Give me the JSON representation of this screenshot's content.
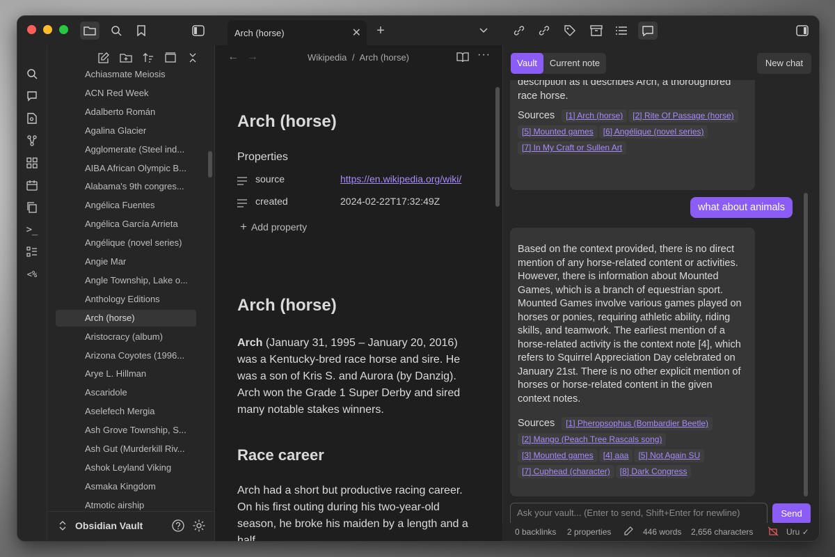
{
  "tab": {
    "title": "Arch (horse)"
  },
  "explorer": {
    "files": [
      "Achiasmate Meiosis",
      "ACN Red Week",
      "Adalberto Román",
      "Agalina Glacier",
      "Agglomerate (Steel ind...",
      "AIBA African Olympic B...",
      "Alabama's 9th congres...",
      "Angélica Fuentes",
      "Angélica García Arrieta",
      "Angélique (novel series)",
      "Angie Mar",
      "Angle Township, Lake o...",
      "Anthology Editions",
      "Arch (horse)",
      "Aristocracy (album)",
      "Arizona Coyotes (1996...",
      "Arye L. Hillman",
      "Ascaridole",
      "Aselefech Mergia",
      "Ash Grove Township, S...",
      "Ash Gut (Murderkill Riv...",
      "Ashok Leyland Viking",
      "Asmaka Kingdom",
      "Atmotic airship"
    ],
    "active_index": 13,
    "vault_name": "Obsidian Vault"
  },
  "editor": {
    "breadcrumb_parent": "Wikipedia",
    "breadcrumb_sep": "/",
    "breadcrumb_current": "Arch (horse)",
    "title": "Arch (horse)",
    "properties_heading": "Properties",
    "properties": [
      {
        "key": "source",
        "value": "https://en.wikipedia.org/wiki/"
      },
      {
        "key": "created",
        "value": "2024-02-22T17:32:49Z"
      }
    ],
    "add_property": "Add property",
    "h1": "Arch (horse)",
    "intro_bold": "Arch",
    "intro_rest": " (January 31, 1995 – January 20, 2016) was a Kentucky-bred race horse and sire. He was a son of Kris S. and Aurora (by Danzig). Arch won the Grade 1 Super Derby and sired many notable stakes winners.",
    "h2": "Race career",
    "race_text": "Arch had a short but productive racing career. On his first outing during his two-year-old season, he broke his maiden by a length and a half."
  },
  "chat": {
    "tab_vault": "Vault",
    "tab_current": "Current note",
    "new_chat": "New chat",
    "msg1_tail_a": "description as it describes Arch, a thoroughbred",
    "msg1_tail_b": "race horse.",
    "sources_label": "Sources",
    "msg1_sources": [
      "[1] Arch (horse)",
      "[2] Rite Of Passage (horse)",
      "[5] Mounted games",
      "[6] Angélique (novel series)",
      "[7] In My Craft or Sullen Art"
    ],
    "user_msg": "what about animals",
    "msg2_text": "Based on the context provided, there is no direct mention of any horse-related content or activities. However, there is information about Mounted Games, which is a branch of equestrian sport. Mounted Games involve various games played on horses or ponies, requiring athletic ability, riding skills, and teamwork. The earliest mention of a horse-related activity is the context note [4], which refers to Squirrel Appreciation Day celebrated on January 21st. There is no other explicit mention of horses or horse-related content in the given context notes.",
    "msg2_sources": [
      "[1] Pheropsophus (Bombardier Beetle)",
      "[2] Mango (Peach Tree Rascals song)",
      "[3] Mounted games",
      "[4] aaa",
      "[5] Not Again SU",
      "[7] Cuphead (character)",
      "[8] Dark Congress"
    ],
    "input_placeholder": "Ask your vault... (Enter to send, Shift+Enter for newline)",
    "send": "Send"
  },
  "status": {
    "backlinks": "0 backlinks",
    "properties": "2 properties",
    "words": "446 words",
    "characters": "2,656 characters",
    "sync": "Uru ✓"
  },
  "colors": {
    "accent": "#8b5cf6",
    "link": "#a78bfa",
    "bg": "#1e1e1e",
    "panel": "#262626"
  }
}
